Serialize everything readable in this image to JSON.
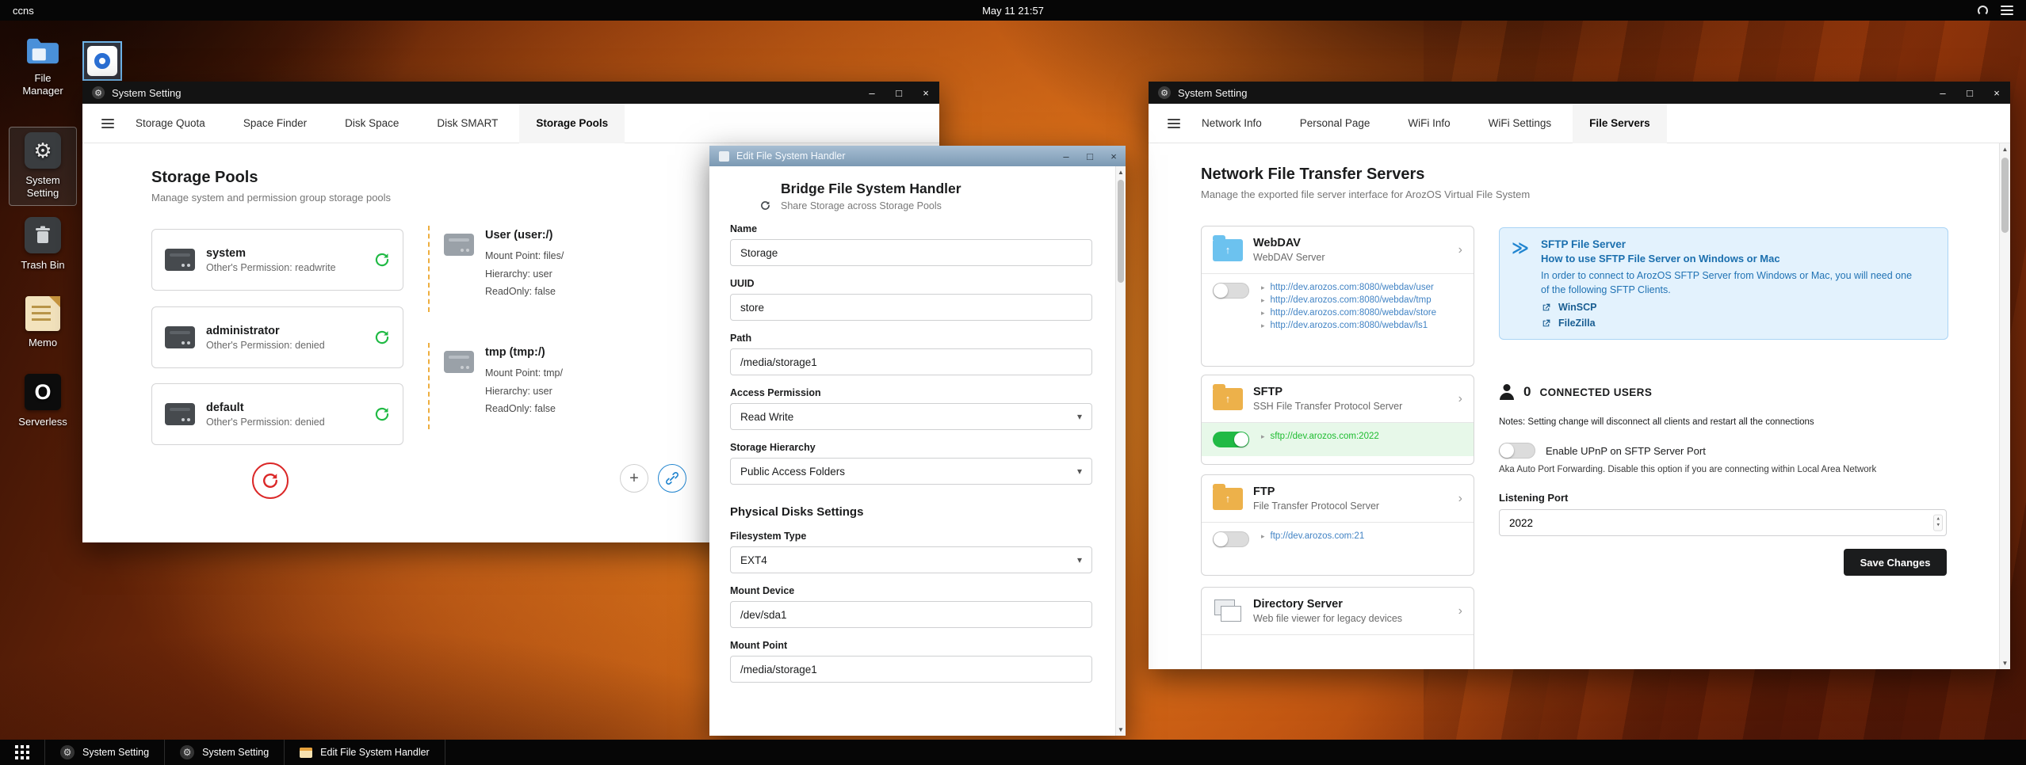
{
  "topbar": {
    "host": "ccns",
    "clock": "May 11 21:57"
  },
  "glyphs": {
    "minimize": "–",
    "maximize": "□",
    "close": "×",
    "chevron_right": "›",
    "caret_down": "▾",
    "link_bullet": "▸",
    "plus": "+",
    "gear": "⚙",
    "double_chevron": "≫",
    "upload_arrow": "↑",
    "spinner_up": "▴",
    "spinner_down": "▾",
    "scroll_up": "▲",
    "scroll_down": "▼",
    "serverless_glyph": "O"
  },
  "desktop": {
    "icons": [
      {
        "label": "File Manager"
      },
      {
        "label": "System Setting"
      },
      {
        "label": "Trash Bin"
      },
      {
        "label": "Memo"
      },
      {
        "label": "Serverless"
      }
    ]
  },
  "storage_window": {
    "title": "System Setting",
    "tabs": [
      "Storage Quota",
      "Space Finder",
      "Disk Space",
      "Disk SMART",
      "Storage Pools"
    ],
    "heading": "Storage Pools",
    "subheading": "Manage system and permission group storage pools",
    "pools": [
      {
        "name": "system",
        "permission": "Other's Permission: readwrite"
      },
      {
        "name": "administrator",
        "permission": "Other's Permission: denied"
      },
      {
        "name": "default",
        "permission": "Other's Permission: denied"
      }
    ],
    "mounts": [
      {
        "title": "User (user:/)",
        "mount_point": "Mount Point: files/",
        "hierarchy": "Hierarchy: user",
        "readonly": "ReadOnly: false"
      },
      {
        "title": "tmp (tmp:/)",
        "mount_point": "Mount Point: tmp/",
        "hierarchy": "Hierarchy: user",
        "readonly": "ReadOnly: false"
      }
    ]
  },
  "edit_window": {
    "title": "Edit File System Handler",
    "heading": "Bridge File System Handler",
    "subheading": "Share Storage across Storage Pools",
    "section_heading": "Physical Disks Settings",
    "fields": {
      "name": {
        "label": "Name",
        "value": "Storage"
      },
      "uuid": {
        "label": "UUID",
        "value": "store"
      },
      "path": {
        "label": "Path",
        "value": "/media/storage1"
      },
      "access": {
        "label": "Access Permission",
        "value": "Read Write"
      },
      "hierarchy": {
        "label": "Storage Hierarchy",
        "value": "Public Access Folders"
      },
      "fstype": {
        "label": "Filesystem Type",
        "value": "EXT4"
      },
      "mount_device": {
        "label": "Mount Device",
        "value": "/dev/sda1"
      },
      "mount_point": {
        "label": "Mount Point",
        "value": "/media/storage1"
      }
    }
  },
  "servers_window": {
    "title": "System Setting",
    "tabs": [
      "Network Info",
      "Personal Page",
      "WiFi Info",
      "WiFi Settings",
      "File Servers"
    ],
    "heading": "Network File Transfer Servers",
    "subheading": "Manage the exported file server interface for ArozOS Virtual File System",
    "webdav": {
      "name": "WebDAV",
      "desc": "WebDAV Server",
      "links": [
        "http://dev.arozos.com:8080/webdav/user",
        "http://dev.arozos.com:8080/webdav/tmp",
        "http://dev.arozos.com:8080/webdav/store",
        "http://dev.arozos.com:8080/webdav/ls1"
      ]
    },
    "sftp": {
      "name": "SFTP",
      "desc": "SSH File Transfer Protocol Server",
      "link": "sftp://dev.arozos.com:2022"
    },
    "ftp": {
      "name": "FTP",
      "desc": "File Transfer Protocol Server",
      "link": "ftp://dev.arozos.com:21"
    },
    "dirserver": {
      "name": "Directory Server",
      "desc": "Web file viewer for legacy devices"
    },
    "sftp_info": {
      "title": "SFTP File Server",
      "subtitle": "How to use SFTP File Server on Windows or Mac",
      "body": "In order to connect to ArozOS SFTP Server from Windows or Mac, you will need one of the following SFTP Clients.",
      "clients": [
        "WinSCP",
        "FileZilla"
      ]
    },
    "connected": {
      "count": "0",
      "label": "CONNECTED USERS",
      "note": "Notes: Setting change will disconnect all clients and restart all the connections"
    },
    "upnp": {
      "label": "Enable UPnP on SFTP Server Port",
      "desc": "Aka Auto Port Forwarding. Disable this option if you are connecting within Local Area Network"
    },
    "port": {
      "label": "Listening Port",
      "value": "2022"
    },
    "save_label": "Save Changes"
  },
  "taskbar": {
    "items": [
      {
        "label": "System Setting"
      },
      {
        "label": "System Setting"
      },
      {
        "label": "Edit File System Handler"
      }
    ]
  }
}
